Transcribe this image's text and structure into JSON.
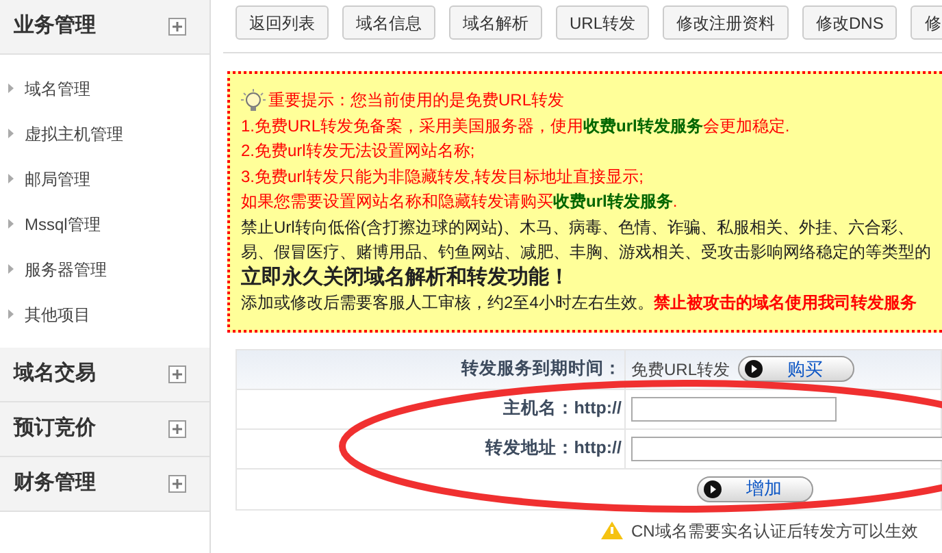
{
  "sidebar": {
    "sections": [
      {
        "title": "业务管理",
        "items": [
          "域名管理",
          "虚拟主机管理",
          "邮局管理",
          "Mssql管理",
          "服务器管理",
          "其他项目"
        ]
      },
      {
        "title": "域名交易"
      },
      {
        "title": "预订竞价"
      },
      {
        "title": "财务管理"
      }
    ]
  },
  "toolbar": [
    "返回列表",
    "域名信息",
    "域名解析",
    "URL转发",
    "修改注册资料",
    "修改DNS",
    "修"
  ],
  "notice": {
    "title": "重要提示：您当前使用的是免费URL转发",
    "lines": [
      {
        "kind": "warning",
        "text": "1.免费URL转发免备案，采用美国服务器，使用**收费url转发服务**会更加稳定."
      },
      {
        "kind": "warning",
        "text": "2.免费url转发无法设置网站名称;"
      },
      {
        "kind": "warning",
        "text": "3.免费url转发只能为非隐藏转发,转发目标地址直接显示;"
      },
      {
        "kind": "warning",
        "text": "如果您需要设置网站名称和隐藏转发请购买**收费url转发服务**."
      },
      {
        "kind": "normal",
        "text": "禁止Url转向低俗(含打擦边球的网站)、木马、病毒、色情、诈骗、私服相关、外挂、六合彩、"
      },
      {
        "kind": "normal",
        "text": "易、假冒医疗、赌博用品、钓鱼网站、减肥、丰胸、游戏相关、受攻击影响网络稳定的等类型的"
      },
      {
        "kind": "emphasis",
        "text": "立即永久关闭域名解析和转发功能！"
      },
      {
        "kind": "footer",
        "text": "添加或修改后需要客服人工审核，约2至4小时左右生效。",
        "alert": "禁止被攻击的域名使用我司转发服务"
      }
    ]
  },
  "form": {
    "rows": [
      {
        "kind": "value",
        "label": "转发服务到期时间：",
        "value": "免费URL转发",
        "button": "购买"
      },
      {
        "kind": "input",
        "label": "主机名：http://"
      },
      {
        "kind": "input",
        "label": "转发地址：http://"
      }
    ],
    "submit": "增加",
    "note": "CN域名需要实名认证后转发方可以生效"
  }
}
